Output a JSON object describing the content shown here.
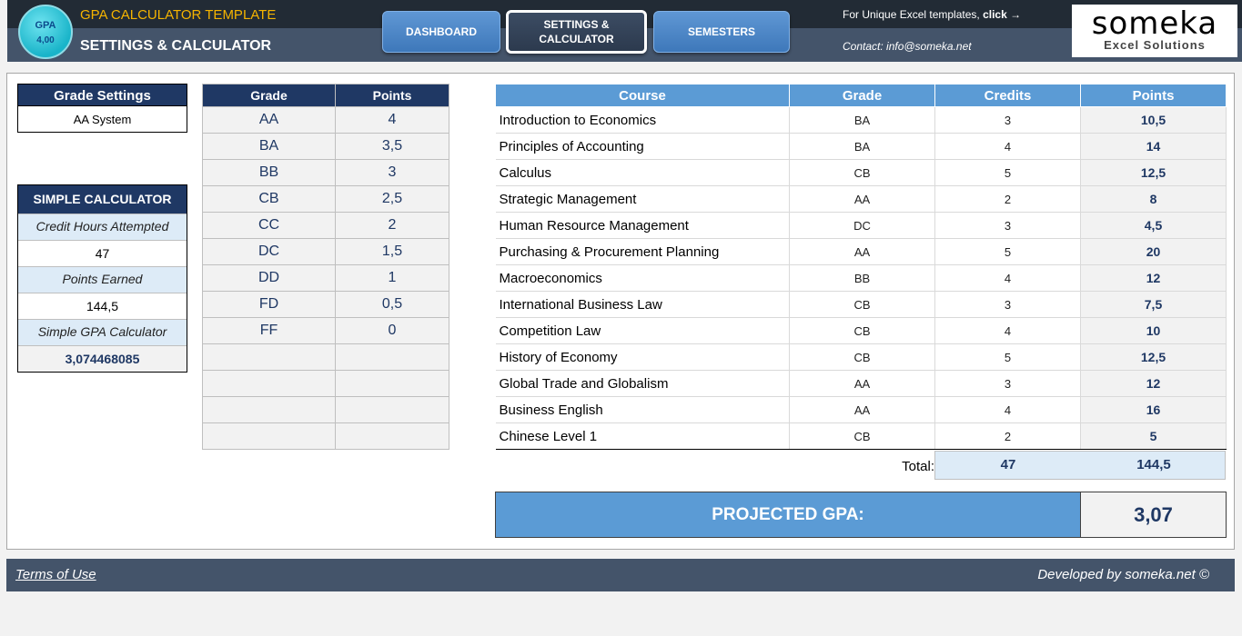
{
  "header": {
    "logo_label": "GPA",
    "logo_value": "4,00",
    "app_title": "GPA CALCULATOR TEMPLATE",
    "page_subtitle": "SETTINGS & CALCULATOR",
    "nav": [
      {
        "label": "DASHBOARD"
      },
      {
        "label_line1": "SETTINGS &",
        "label_line2": "CALCULATOR"
      },
      {
        "label": "SEMESTERS"
      }
    ],
    "promo_text": "For Unique Excel templates, ",
    "promo_click": "click",
    "promo_arrow": "→",
    "contact": "Contact: info@someka.net",
    "brand_name": "someka",
    "brand_tagline": "Excel Solutions"
  },
  "grade_settings": {
    "title": "Grade Settings",
    "value": "AA System"
  },
  "simple_calculator": {
    "title": "SIMPLE CALCULATOR",
    "credit_label": "Credit Hours Attempted",
    "credit_value": "47",
    "points_label": "Points Earned",
    "points_value": "144,5",
    "gpa_label": "Simple GPA Calculator",
    "gpa_value": "3,074468085"
  },
  "grade_table": {
    "headers": [
      "Grade",
      "Points"
    ],
    "rows": [
      [
        "AA",
        "4"
      ],
      [
        "BA",
        "3,5"
      ],
      [
        "BB",
        "3"
      ],
      [
        "CB",
        "2,5"
      ],
      [
        "CC",
        "2"
      ],
      [
        "DC",
        "1,5"
      ],
      [
        "DD",
        "1"
      ],
      [
        "FD",
        "0,5"
      ],
      [
        "FF",
        "0"
      ],
      [
        "",
        ""
      ],
      [
        "",
        ""
      ],
      [
        "",
        ""
      ],
      [
        "",
        ""
      ]
    ]
  },
  "course_table": {
    "headers": [
      "Course",
      "Grade",
      "Credits",
      "Points"
    ],
    "rows": [
      [
        "Introduction to Economics",
        "BA",
        "3",
        "10,5"
      ],
      [
        "Principles of Accounting",
        "BA",
        "4",
        "14"
      ],
      [
        "Calculus",
        "CB",
        "5",
        "12,5"
      ],
      [
        "Strategic Management",
        "AA",
        "2",
        "8"
      ],
      [
        "Human Resource Management",
        "DC",
        "3",
        "4,5"
      ],
      [
        "Purchasing & Procurement Planning",
        "AA",
        "5",
        "20"
      ],
      [
        "Macroeconomics",
        "BB",
        "4",
        "12"
      ],
      [
        "International Business Law",
        "CB",
        "3",
        "7,5"
      ],
      [
        "Competition Law",
        "CB",
        "4",
        "10"
      ],
      [
        "History of Economy",
        "CB",
        "5",
        "12,5"
      ],
      [
        "Global Trade and Globalism",
        "AA",
        "3",
        "12"
      ],
      [
        "Business English",
        "AA",
        "4",
        "16"
      ],
      [
        "Chinese Level 1",
        "CB",
        "2",
        "5"
      ]
    ],
    "total_label": "Total:",
    "total_credits": "47",
    "total_points": "144,5"
  },
  "projected": {
    "label": "PROJECTED GPA:",
    "value": "3,07"
  },
  "footer": {
    "terms": "Terms of Use",
    "developed": "Developed by someka.net ©"
  }
}
